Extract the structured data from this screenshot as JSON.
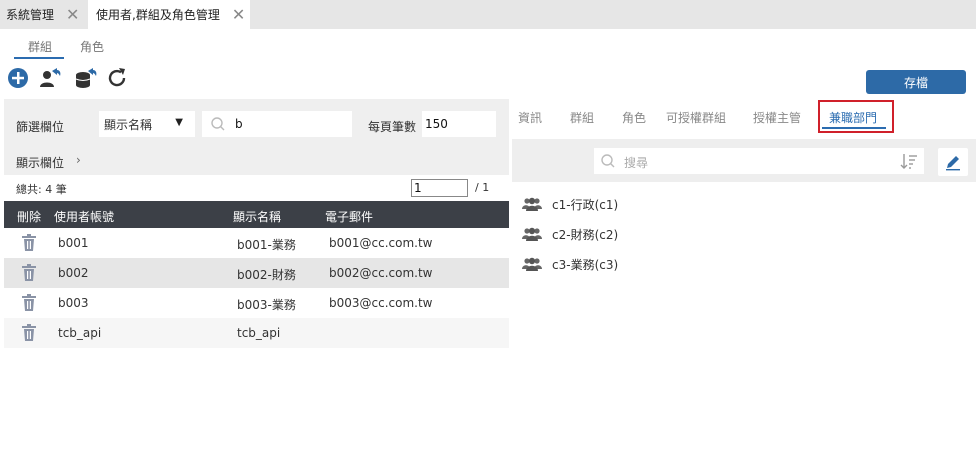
{
  "top_tabs": [
    {
      "label": "系統管理"
    },
    {
      "label": "使用者,群組及角色管理"
    }
  ],
  "sub_tabs": [
    "群組",
    "角色"
  ],
  "toolbar": {
    "save_label": "存檔"
  },
  "filter": {
    "field_label": "篩選欄位",
    "field_value": "顯示名稱",
    "search_value": "b",
    "page_size_label": "每頁筆數",
    "page_size_value": "150",
    "show_columns_label": "顯示欄位"
  },
  "pagination": {
    "total": "總共: 4 筆",
    "page": "1",
    "of": "/  1"
  },
  "table": {
    "headers": [
      "刪除",
      "使用者帳號",
      "顯示名稱",
      "電子郵件"
    ],
    "rows": [
      {
        "account": "b001",
        "name": "b001-業務",
        "email": "b001@cc.com.tw"
      },
      {
        "account": "b002",
        "name": "b002-財務",
        "email": "b002@cc.com.tw"
      },
      {
        "account": "b003",
        "name": "b003-業務",
        "email": "b003@cc.com.tw"
      },
      {
        "account": "tcb_api",
        "name": "tcb_api",
        "email": ""
      }
    ]
  },
  "right_tabs": [
    "資訊",
    "群組",
    "角色",
    "可授權群組",
    "授權主管",
    "兼職部門"
  ],
  "right_search": {
    "placeholder": "搜尋"
  },
  "departments": [
    "c1-行政(c1)",
    "c2-財務(c2)",
    "c3-業務(c3)"
  ],
  "colors": {
    "accent": "#2d6aa7",
    "highlight": "#d0202a",
    "header_bg": "#3c4047"
  }
}
